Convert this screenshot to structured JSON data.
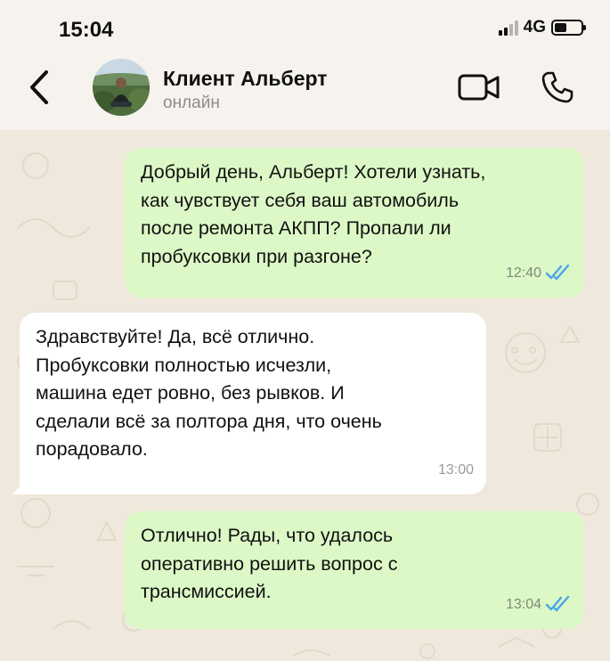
{
  "status_bar": {
    "time": "15:04",
    "network": "4G",
    "battery_level_fraction": 0.45
  },
  "header": {
    "contact_name": "Клиент Альберт",
    "contact_status": "онлайн",
    "icons": {
      "back": "chevron-left-icon",
      "video": "video-camera-icon",
      "call": "phone-icon"
    }
  },
  "colors": {
    "outgoing_bubble": "#dbf8c6",
    "incoming_bubble": "#ffffff",
    "read_ticks": "#4aa6e8",
    "background": "#efe8dc"
  },
  "messages": [
    {
      "direction": "out",
      "text": "Добрый день, Альберт! Хотели узнать,\nкак чувствует себя ваш автомобиль\nпосле ремонта АКПП? Пропали ли\nпробуксовки при разгоне?",
      "time": "12:40",
      "read": true
    },
    {
      "direction": "in",
      "text": "Здравствуйте! Да, всё отлично.\nПробуксовки полностью исчезли,\nмашина едет ровно, без рывков. И\nсделали всё за полтора дня, что очень\nпорадовало.",
      "time": "13:00"
    },
    {
      "direction": "out",
      "text": "Отлично! Рады, что удалось\nоперативно решить вопрос с\nтрансмиссией.",
      "time": "13:04",
      "read": true
    }
  ]
}
